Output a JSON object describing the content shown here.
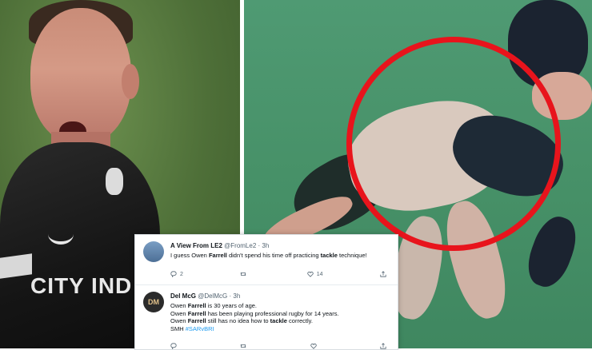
{
  "left_photo": {
    "jersey_text": "CITY IND"
  },
  "tweets": [
    {
      "display_name": "A View From LE2",
      "handle": "@FromLe2",
      "time": "3h",
      "lines": [
        [
          "I guess Owen ",
          "Farrell",
          " didn't spend his time off practicing ",
          "tackle",
          " technique!"
        ]
      ],
      "replies": "2",
      "retweets": "",
      "likes": "14"
    },
    {
      "display_name": "Del McG",
      "handle": "@DelMcG",
      "time": "3h",
      "avatar_text": "DM",
      "line1": [
        "Owen ",
        "Farrell",
        " is 30 years of age."
      ],
      "line2": [
        "Owen ",
        "Farrell",
        " has been playing professional rugby for 14 years."
      ],
      "line3": [
        "Owen ",
        "Farrell",
        " still has no idea how to ",
        "tackle",
        " correctly."
      ],
      "line4_text": "SMH ",
      "line4_tag": "#SARvBRI",
      "replies": "",
      "retweets": "",
      "likes": ""
    }
  ],
  "colors": {
    "circle": "#e8141c",
    "link": "#1d9bf0"
  }
}
